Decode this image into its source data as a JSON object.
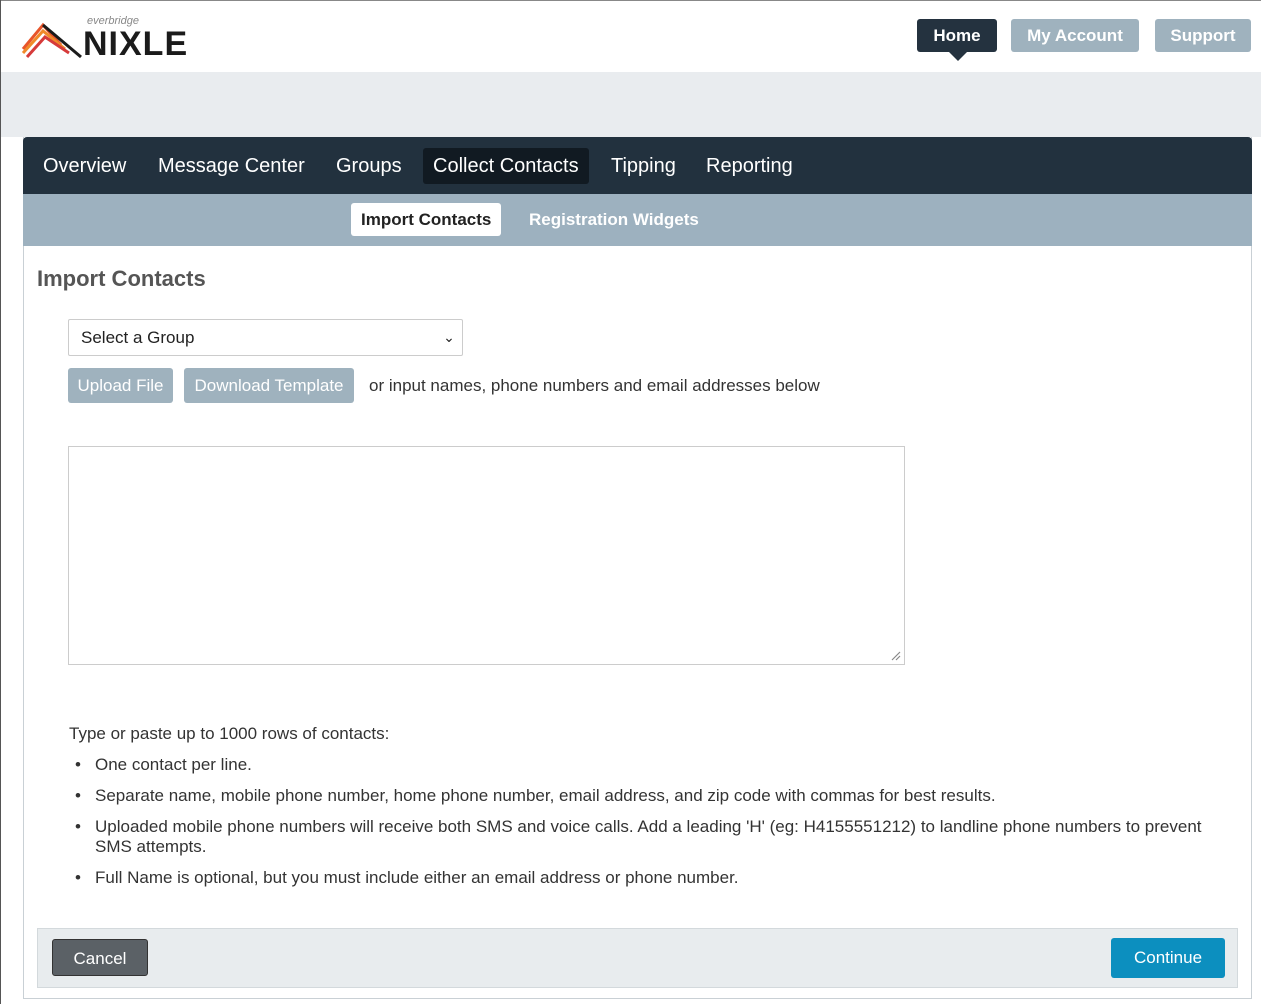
{
  "brand": {
    "small_text": "everbridge",
    "name": "NIXLE"
  },
  "topnav": {
    "home": "Home",
    "my_account": "My Account",
    "support": "Support"
  },
  "mainnav": {
    "items": [
      {
        "label": "Overview"
      },
      {
        "label": "Message Center"
      },
      {
        "label": "Groups"
      },
      {
        "label": "Collect Contacts",
        "active": true
      },
      {
        "label": "Tipping"
      },
      {
        "label": "Reporting"
      }
    ]
  },
  "subnav": {
    "import_contacts": "Import Contacts",
    "registration_widgets": "Registration Widgets"
  },
  "page": {
    "title": "Import Contacts",
    "group_select": "Select a Group",
    "upload_file": "Upload File",
    "download_template": "Download Template",
    "helper_text": "or input names, phone numbers and email addresses below",
    "contacts_value": ""
  },
  "instructions": {
    "intro": "Type or paste up to 1000 rows of contacts:",
    "bullets": [
      "One contact per line.",
      "Separate name, mobile phone number, home phone number, email address, and zip code with commas for best results.",
      "Uploaded mobile phone numbers will receive both SMS and voice calls. Add a leading 'H' (eg: H4155551212) to landline phone numbers to prevent SMS attempts.",
      "Full Name is optional, but you must include either an email address or phone number."
    ]
  },
  "footer": {
    "cancel": "Cancel",
    "continue": "Continue"
  },
  "colors": {
    "nav_dark": "#22313e",
    "nav_light": "#9db1bf",
    "accent": "#0c8fbf"
  }
}
